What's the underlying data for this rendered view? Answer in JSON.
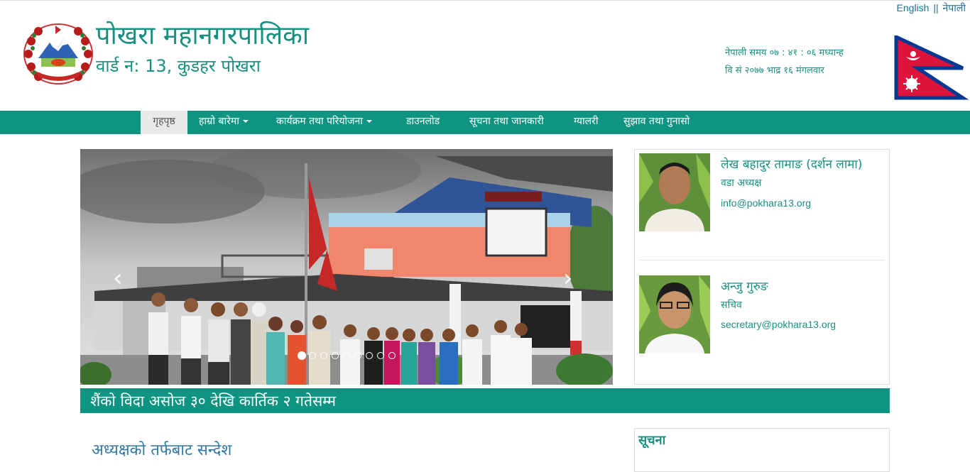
{
  "header": {
    "lang_english": "English",
    "lang_separator": "||",
    "lang_nepali": "नेपाली",
    "title": "पोखरा महानगरपालिका",
    "subtitle": "वार्ड न: 13, कुडहर पोखरा",
    "time_line1": "नेपाली समय ०७ : ४१ : ०६ मध्यान्ह",
    "time_line2": "वि सं २०७७ भाद्र १६ मंगलवार"
  },
  "nav": {
    "items": [
      {
        "label": "गृहपृष्ठ",
        "active": true,
        "dropdown": false
      },
      {
        "label": "हाम्रो बारेमा",
        "active": false,
        "dropdown": true
      },
      {
        "label": "कार्यक्रम तथा परियोजना",
        "active": false,
        "dropdown": true
      },
      {
        "label": "डाउनलोड",
        "active": false,
        "dropdown": false
      },
      {
        "label": "सूचना तथा जानकारी",
        "active": false,
        "dropdown": false
      },
      {
        "label": "ग्यालरी",
        "active": false,
        "dropdown": false
      },
      {
        "label": "सुझाव तथा गुनासो",
        "active": false,
        "dropdown": false
      }
    ]
  },
  "carousel": {
    "prev_icon": "chevron-left-icon",
    "next_icon": "chevron-right-icon",
    "indicator_count": 9,
    "active_indicator": 1
  },
  "ticker": {
    "text": "शैंको विदा असोज ३० देखि कार्तिक २ गतेसम्म"
  },
  "officials": [
    {
      "name": "लेख बहादुर तामाङ (दर्शन लामा)",
      "role": "वडा अध्यक्ष",
      "email": "info@pokhara13.org"
    },
    {
      "name": "अन्जु गुरुङ",
      "role": "सचिव",
      "email": "secretary@pokhara13.org"
    }
  ],
  "main": {
    "message_heading": "अध्यक्षको तर्फबाट सन्देश"
  },
  "notice": {
    "title": "सूचना"
  },
  "colors": {
    "brand_teal": "#0f9481",
    "text_teal": "#17907f",
    "link_blue": "#1f6f9a",
    "flag_red": "#dc143c",
    "flag_blue": "#003893"
  }
}
